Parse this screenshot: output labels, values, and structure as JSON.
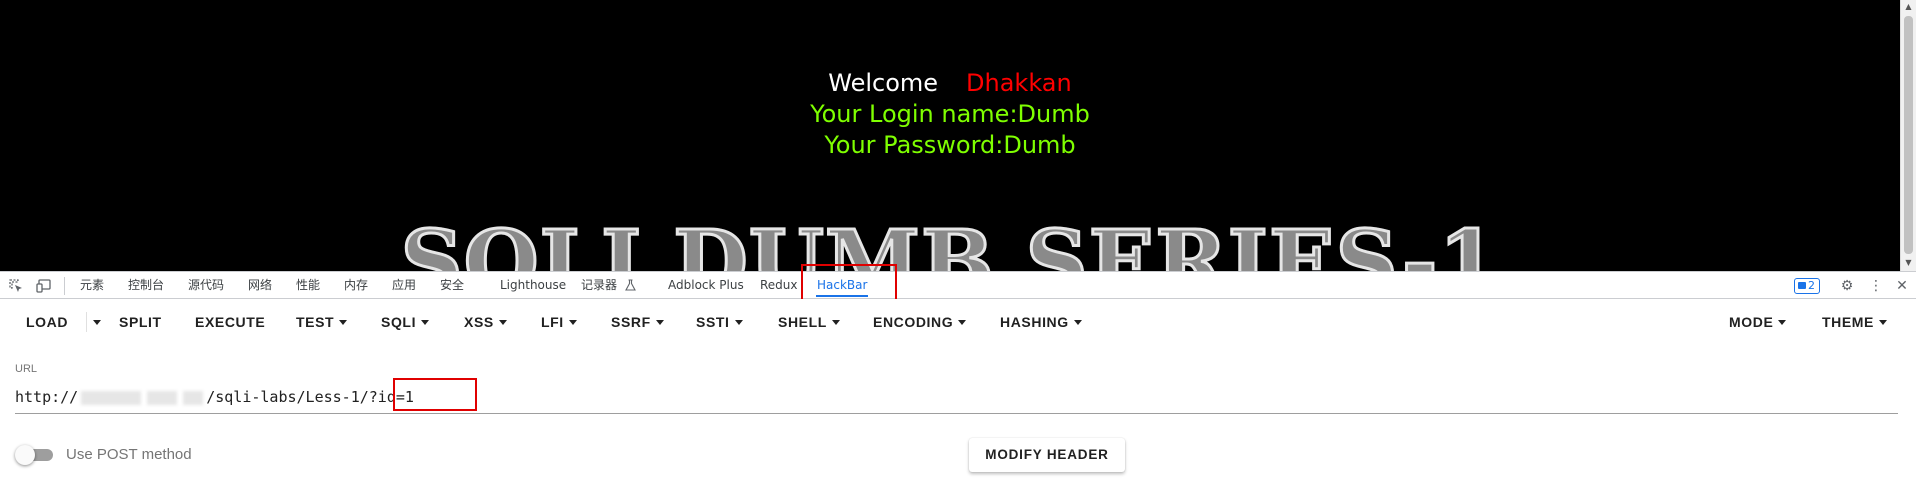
{
  "page": {
    "welcome_word": "Welcome",
    "welcome_name": "Dhakkan",
    "login_name": "Your Login name:Dumb",
    "password": "Your Password:Dumb",
    "banner": "SQLI DUMB SERIES-1"
  },
  "devtools": {
    "tabs": [
      "元素",
      "控制台",
      "源代码",
      "网络",
      "性能",
      "内存",
      "应用",
      "安全",
      "Lighthouse",
      "记录器",
      "Adblock Plus",
      "Redux",
      "HackBar"
    ],
    "active_tab": "HackBar",
    "issues_count": "2"
  },
  "hackbar": {
    "menus": [
      "LOAD",
      "SPLIT",
      "EXECUTE",
      "TEST",
      "SQLI",
      "XSS",
      "LFI",
      "SSRF",
      "SSTI",
      "SHELL",
      "ENCODING",
      "HASHING"
    ],
    "right_menus": [
      "MODE",
      "THEME"
    ],
    "url_label": "URL",
    "url_prefix": "http://",
    "url_path": "/sqli-labs/Less-1/",
    "url_query": "?id=1",
    "post_label": "Use POST method",
    "post_enabled": false,
    "modify_header": "MODIFY HEADER"
  },
  "colors": {
    "page_bg": "#000000",
    "welcome_white": "#ffffff",
    "welcome_red": "#ff0000",
    "info_green": "#7fff00",
    "devtools_accent": "#1a73e8",
    "highlight_red": "#e00000"
  }
}
